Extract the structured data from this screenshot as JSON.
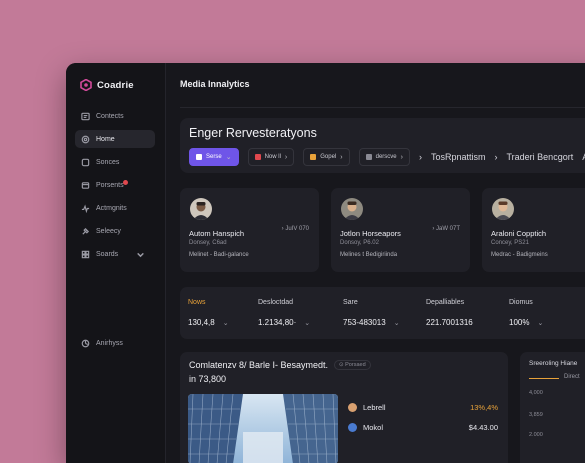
{
  "app": {
    "name": "Coadrie"
  },
  "sidebar": {
    "items": [
      {
        "label": "Contects",
        "icon": "contacts-icon"
      },
      {
        "label": "Home",
        "icon": "home-icon",
        "active": true
      },
      {
        "label": "Sonces",
        "icon": "sources-icon"
      },
      {
        "label": "Porsents",
        "icon": "reports-icon",
        "badge": true
      },
      {
        "label": "Actmgnits",
        "icon": "activity-icon"
      },
      {
        "label": "Seleecy",
        "icon": "select-icon"
      },
      {
        "label": "Soards",
        "icon": "boards-icon",
        "expandable": true
      }
    ],
    "bottom": {
      "label": "Anirhyss",
      "icon": "analytics-icon"
    }
  },
  "header": {
    "title": "Media Innalytics"
  },
  "hero": {
    "title": "Enger Rervesteratyons",
    "pills": [
      {
        "label": "Serse",
        "icon": "filter-icon",
        "primary": true,
        "color": "#ffffff"
      },
      {
        "label": "Now ll",
        "icon": "chart-icon",
        "color": "#e0484e"
      },
      {
        "label": "Gopel",
        "icon": "flag-icon",
        "color": "#e8a23a"
      },
      {
        "label": "derscve",
        "icon": "grid-icon",
        "color": "#8a8a94"
      }
    ],
    "trail": [
      "TosRpnattism",
      "Traderi Bencgort",
      "A"
    ]
  },
  "profiles": [
    {
      "name": "Autom Hanspich",
      "meta": "JuIV 070",
      "sub": "Donsey, C6ad",
      "desc": "Melinet - Badi-galance"
    },
    {
      "name": "Jotlon Horseapors",
      "meta": "JaW 07T",
      "sub": "Donsoy, P6.02",
      "desc": "Melines t Bedigiriinda"
    },
    {
      "name": "Araloni Copptich",
      "meta": "",
      "sub": "Concey, PS21",
      "desc": "Medrac - Badigmeins"
    }
  ],
  "stats": [
    {
      "label": "Nows",
      "value": "130,4,8",
      "accent": true
    },
    {
      "label": "Desloctdad",
      "value": "1.2134,80·"
    },
    {
      "label": "Sare",
      "value": "753-483013"
    },
    {
      "label": "Depalliables",
      "value": "221.7001316"
    },
    {
      "label": "Diomus",
      "value": "100%"
    }
  ],
  "bottom": {
    "title": "Comlatenzv 8/ Barle I- Besaymedt.",
    "badge": "Porsaed",
    "amount": "in 73,800",
    "rows": [
      {
        "label": "Lebrell",
        "value": "13%,4%",
        "accent": true,
        "color": "#d8a070"
      },
      {
        "label": "Mokol",
        "value": "$4.43.00",
        "accent": false,
        "color": "#4a7bd0"
      }
    ]
  },
  "side_chart": {
    "title": "Sreeroling Hiane",
    "legend": "Direct",
    "ticks": [
      "4,000",
      "3,859",
      "2.000"
    ]
  }
}
